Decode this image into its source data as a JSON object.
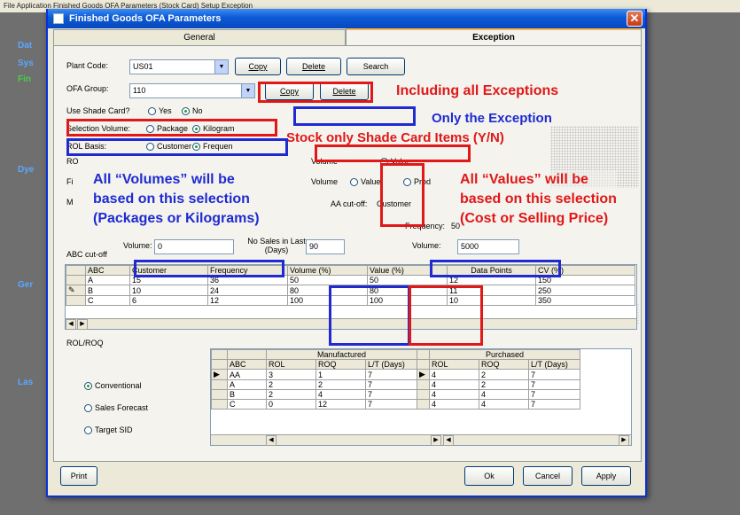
{
  "menubar": "File   Application   Finished Goods OFA Parameters   (Stock Card)   Setup   Exception",
  "side_labels": [
    "Dat",
    "Sys",
    "Fin",
    "Dye",
    "Ger",
    "Las"
  ],
  "dialog": {
    "title": "Finished Goods OFA Parameters",
    "close": "✕",
    "tabs": {
      "general": "General",
      "exception": "Exception"
    }
  },
  "form": {
    "plant_code_label": "Plant Code:",
    "plant_code_value": "US01",
    "copy1": "Copy",
    "delete1": "Delete",
    "search": "Search",
    "ofa_group_label": "OFA Group:",
    "ofa_group_value": "110",
    "copy2": "Copy",
    "delete2": "Delete",
    "shade_card_label": "Use Shade Card?",
    "yes": "Yes",
    "no": "No",
    "selection_label": "Selection  Volume:",
    "package": "Package",
    "kilogram": "Kilogram",
    "rol_basis_label": "ROL Basis:",
    "customer": "Customer",
    "frequency_opt": "Frequen",
    "ro_label": "RO",
    "fi_label": "Fi",
    "m_label": "M",
    "volume1": "Volume",
    "volume2": "Volume",
    "value1": "Value",
    "value2": "Value",
    "pro": "Prod",
    "aa_cutoff": "AA cut-off:",
    "customer2": "Customer",
    "frequency_label": "Frequency:",
    "freq_val": "50",
    "abc_cutoff_label": "ABC cut-off",
    "volume_label": "Volume:",
    "volume_val": "0",
    "no_sales_label": "No Sales in Last (Days)",
    "no_sales_val": "90",
    "volume_label2": "Volume:",
    "volume_val2": "5000"
  },
  "abc_grid": {
    "headers": [
      "ABC",
      "Customer",
      "Frequency",
      "Volume (%)",
      "Value (%)",
      "Data Points",
      "CV (%)"
    ],
    "rows": [
      {
        "abc": "A",
        "customer": "15",
        "frequency": "36",
        "volume": "50",
        "value": "50",
        "dp": "12",
        "cv": "150"
      },
      {
        "abc": "B",
        "customer": "10",
        "frequency": "24",
        "volume": "80",
        "value": "80",
        "dp": "11",
        "cv": "250"
      },
      {
        "abc": "C",
        "customer": "6",
        "frequency": "12",
        "volume": "100",
        "value": "100",
        "dp": "10",
        "cv": "350"
      }
    ]
  },
  "rolroq": {
    "label": "ROL/ROQ",
    "options": [
      "Conventional",
      "Sales Forecast",
      "Target SID"
    ],
    "manufactured": "Manufactured",
    "purchased": "Purchased",
    "headers": [
      "ABC",
      "ROL",
      "ROQ",
      "L/T (Days)",
      "ROL",
      "ROQ",
      "L/T (Days)"
    ],
    "rows": [
      [
        "AA",
        "3",
        "1",
        "7",
        "4",
        "2",
        "7"
      ],
      [
        "A",
        "2",
        "2",
        "7",
        "4",
        "2",
        "7"
      ],
      [
        "B",
        "2",
        "4",
        "7",
        "4",
        "4",
        "7"
      ],
      [
        "C",
        "0",
        "12",
        "7",
        "4",
        "4",
        "7"
      ]
    ]
  },
  "footer": {
    "print": "Print",
    "ok": "Ok",
    "cancel": "Cancel",
    "apply": "Apply"
  },
  "annotations": {
    "including": "Including all Exceptions",
    "only_exception": "Only the Exception",
    "stock_only": "Stock only Shade Card Items (Y/N)",
    "volumes_1": "All “Volumes” will be",
    "volumes_2": "based on this selection",
    "volumes_3": "(Packages or Kilograms)",
    "values_1": "All “Values” will be",
    "values_2": "based on this selection",
    "values_3": "(Cost or Selling Price)"
  },
  "colors": {
    "annotation_red": "#e01818",
    "annotation_blue": "#1f2bd0",
    "title_blue": "#0a5ad4"
  }
}
